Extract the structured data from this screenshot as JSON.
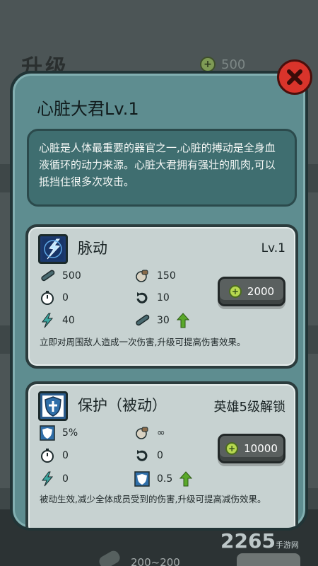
{
  "background": {
    "title": "升级",
    "coin_value": "500",
    "bottom_value": "200~200"
  },
  "modal": {
    "title": "心脏大君Lv.1",
    "description": "心脏是人体最重要的器官之一,心脏的搏动是全身血液循环的动力来源。心脏大君拥有强壮的肌肉,可以抵挡住很多次攻击。"
  },
  "skills": [
    {
      "name": "脉动",
      "level": "Lv.1",
      "icon": "lightning-pulse-icon",
      "stats": {
        "damage": "500",
        "range": "150",
        "cooldown": "0",
        "count": "10",
        "energy": "40",
        "upgrade_damage": "30"
      },
      "cost": "2000",
      "description": "立即对周围敌人造成一次伤害,升级可提高伤害效果。"
    },
    {
      "name": "保护（被动）",
      "unlock": "英雄5级解锁",
      "icon": "shield-cross-icon",
      "stats": {
        "reduction": "5%",
        "range": "∞",
        "cooldown": "0",
        "count": "0",
        "energy": "0",
        "upgrade_reduction": "0.5"
      },
      "cost": "10000",
      "description": "被动生效,减少全体成员受到的伤害,升级可提高减伤效果。"
    }
  ],
  "watermark": {
    "brand": "2265",
    "sub": "手游网"
  },
  "colors": {
    "modal_bg": "#5e8d90",
    "card_bg": "#c7d2d1",
    "close_red": "#d9342b",
    "coin_green": "#b7d850",
    "arrow_green": "#5aa82a"
  }
}
